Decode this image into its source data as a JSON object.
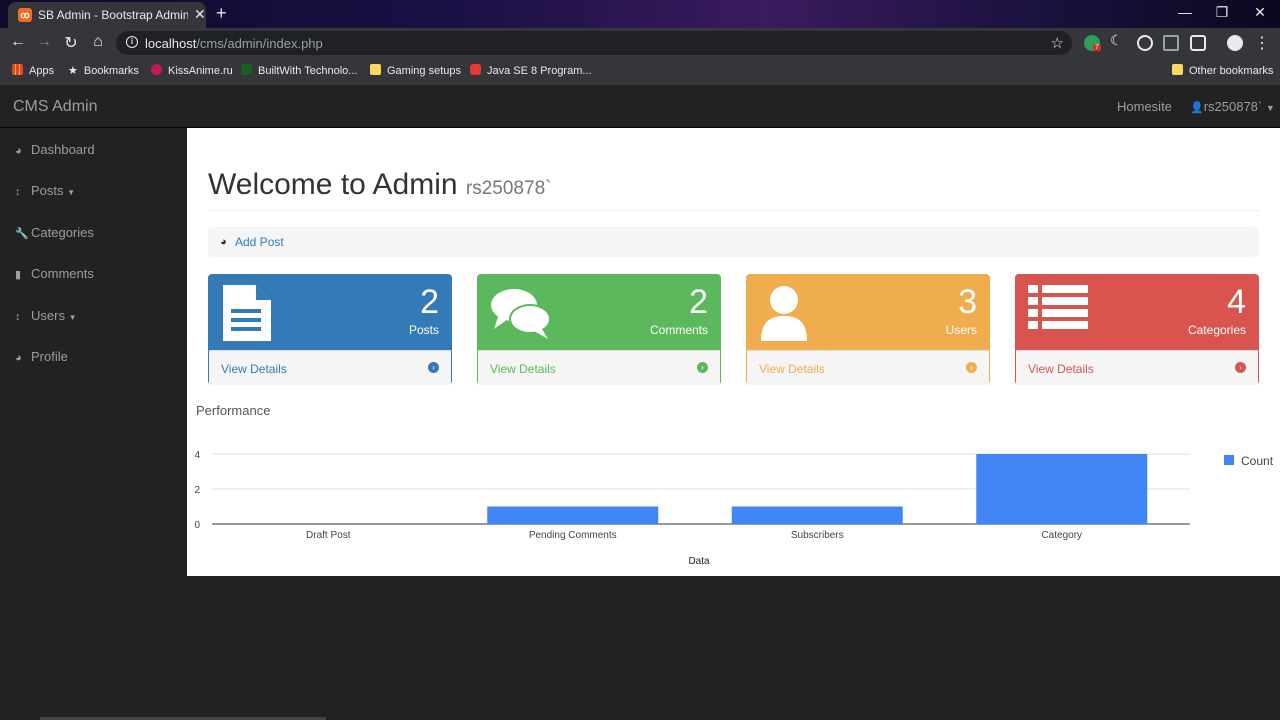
{
  "browser": {
    "tab_title": "SB Admin - Bootstrap Admin Tem",
    "tab_favicon": "xampp-icon",
    "url_host": "localhost",
    "url_path": "/cms/admin/index.php",
    "bookmarks": [
      "Apps",
      "Bookmarks",
      "KissAnime.ru",
      "BuiltWith Technolo...",
      "Gaming setups",
      "Java SE 8 Program..."
    ],
    "other_bookmarks": "Other bookmarks",
    "extension_badge": "7"
  },
  "app": {
    "brand": "CMS Admin",
    "nav_homesite": "Homesite",
    "nav_user": "rs250878`",
    "sidebar": [
      {
        "label": "Dashboard",
        "icon": "dashboard-icon"
      },
      {
        "label": "Posts",
        "icon": "arrows-v-icon",
        "caret": true
      },
      {
        "label": "Categories",
        "icon": "wrench-icon"
      },
      {
        "label": "Comments",
        "icon": "file-icon"
      },
      {
        "label": "Users",
        "icon": "arrows-v-icon",
        "caret": true
      },
      {
        "label": "Profile",
        "icon": "dashboard-icon"
      }
    ],
    "page_title": "Welcome to Admin",
    "page_subtitle": "rs250878`",
    "breadcrumb_link": "Add Post",
    "panels": [
      {
        "count": "2",
        "label": "Posts",
        "link": "View Details",
        "color": "#337ab7",
        "icon": "file-text-icon"
      },
      {
        "count": "2",
        "label": "Comments",
        "link": "View Details",
        "color": "#5cb85c",
        "icon": "comments-icon"
      },
      {
        "count": "3",
        "label": "Users",
        "link": "View Details",
        "color": "#f0ad4e",
        "icon": "user-icon"
      },
      {
        "count": "4",
        "label": "Categories",
        "link": "View Details",
        "color": "#d9534f",
        "icon": "list-icon"
      }
    ],
    "performance_title": "Performance"
  },
  "chart_data": {
    "type": "bar",
    "categories": [
      "Draft Post",
      "Pending Comments",
      "Subscribers",
      "Category"
    ],
    "series": [
      {
        "name": "Count",
        "values": [
          0,
          1,
          1,
          4
        ],
        "color": "#4285f4"
      }
    ],
    "xlabel": "Data",
    "ylabel": "",
    "yticks": [
      "0",
      "2",
      "4"
    ],
    "ylim": [
      0,
      4
    ],
    "grid": true,
    "legend": "right"
  }
}
